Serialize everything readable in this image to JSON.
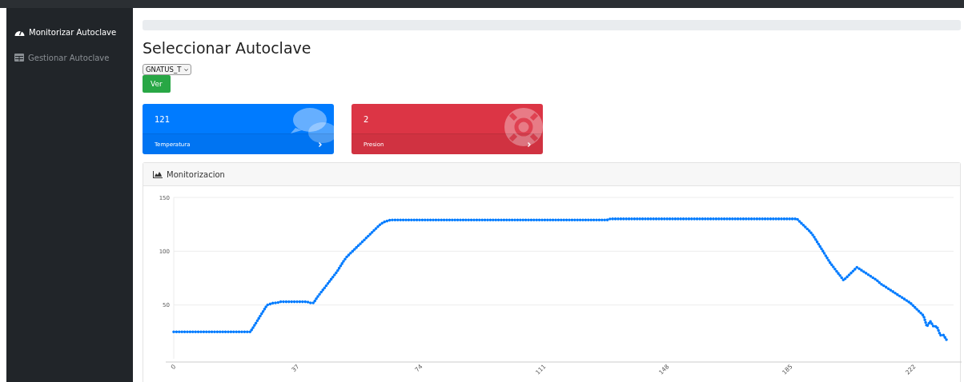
{
  "sidebar": {
    "items": [
      {
        "label": "Monitorizar Autoclave",
        "selected": true
      },
      {
        "label": "Gestionar Autoclave",
        "selected": false
      }
    ]
  },
  "page": {
    "title": "Seleccionar Autoclave",
    "select_value": "GNATUS_T",
    "button": "Ver"
  },
  "cards": [
    {
      "value": "121",
      "label": "Temperatura",
      "color": "#007bff"
    },
    {
      "value": "2",
      "label": "Presion",
      "color": "#dc3545"
    }
  ],
  "panel": {
    "title": "Monitorizacion",
    "chart_data": {
      "type": "line",
      "x": [
        0,
        1,
        2,
        3,
        4,
        5,
        6,
        7,
        8,
        9,
        10,
        11,
        12,
        13,
        14,
        15,
        16,
        17,
        18,
        19,
        20,
        21,
        22,
        23,
        24,
        25,
        26,
        27,
        28,
        29,
        30,
        31,
        32,
        33,
        34,
        35,
        36,
        37,
        38,
        39,
        40,
        41,
        42,
        43,
        44,
        45,
        46,
        47,
        48,
        49,
        50,
        51,
        52,
        53,
        54,
        55,
        56,
        57,
        58,
        59,
        60,
        61,
        62,
        63,
        64,
        65,
        66,
        67,
        68,
        69,
        70,
        71,
        72,
        73,
        74,
        75,
        76,
        77,
        78,
        79,
        80,
        81,
        82,
        83,
        84,
        85,
        86,
        87,
        88,
        89,
        90,
        91,
        92,
        93,
        94,
        95,
        96,
        97,
        98,
        99,
        100,
        101,
        102,
        103,
        104,
        105,
        106,
        107,
        108,
        109,
        110,
        111,
        112,
        113,
        114,
        115,
        116,
        117,
        118,
        119,
        120,
        121,
        122,
        123,
        124,
        125,
        126,
        127,
        128,
        129,
        130,
        131,
        132,
        133,
        134,
        135,
        136,
        137,
        138,
        139,
        140,
        141,
        142,
        143,
        144,
        145,
        146,
        147,
        148,
        149,
        150,
        151,
        152,
        153,
        154,
        155,
        156,
        157,
        158,
        159,
        160,
        161,
        162,
        163,
        164,
        165,
        166,
        167,
        168,
        169,
        170,
        171,
        172,
        173,
        174,
        175,
        176,
        177,
        178,
        179,
        180,
        181,
        182,
        183,
        184,
        185,
        186,
        187,
        188,
        189,
        190,
        191,
        192,
        193,
        194,
        195,
        196,
        197,
        198,
        199,
        200,
        201,
        202,
        203,
        204,
        205,
        206,
        207,
        208,
        209,
        210,
        211,
        212,
        213,
        214,
        215,
        216,
        217,
        218,
        219,
        220,
        221,
        222,
        223,
        224,
        225,
        226,
        227,
        228,
        229,
        230,
        231,
        232
      ],
      "xlim": [
        0,
        234
      ],
      "xticks": [
        0,
        37,
        74,
        111,
        148,
        185,
        222
      ],
      "yticks": [
        50,
        100,
        150
      ],
      "ylim": [
        0,
        150
      ],
      "series": [
        {
          "color": "#007bff",
          "line_style": "dotted",
          "values": [
            25,
            25,
            25,
            25,
            25,
            25,
            25,
            25,
            25,
            25,
            25,
            25,
            25,
            25,
            25,
            25,
            25,
            25,
            25,
            25,
            25,
            25,
            25,
            25,
            30,
            35,
            40,
            45,
            50,
            51,
            52,
            52,
            53,
            53,
            53,
            53,
            53,
            53,
            53,
            53,
            53,
            52,
            52,
            57,
            61,
            65,
            69,
            73,
            77,
            81,
            86,
            91,
            95,
            98,
            101,
            104,
            107,
            110,
            113,
            116,
            119,
            122,
            125,
            127,
            128,
            129,
            129,
            129,
            129,
            129,
            129,
            129,
            129,
            129,
            129,
            129,
            129,
            129,
            129,
            129,
            129,
            129,
            129,
            129,
            129,
            129,
            129,
            129,
            129,
            129,
            129,
            129,
            129,
            129,
            129,
            129,
            129,
            129,
            129,
            129,
            129,
            129,
            129,
            129,
            129,
            129,
            129,
            129,
            129,
            129,
            129,
            129,
            129,
            129,
            129,
            129,
            129,
            129,
            129,
            129,
            129,
            129,
            129,
            129,
            129,
            129,
            129,
            129,
            129,
            129,
            129,
            130,
            130,
            130,
            130,
            130,
            130,
            130,
            130,
            130,
            130,
            130,
            130,
            130,
            130,
            130,
            130,
            130,
            130,
            130,
            130,
            130,
            130,
            130,
            130,
            130,
            130,
            130,
            130,
            130,
            130,
            130,
            130,
            130,
            130,
            130,
            130,
            130,
            130,
            130,
            130,
            130,
            130,
            130,
            130,
            130,
            130,
            130,
            130,
            130,
            130,
            130,
            130,
            130,
            130,
            130,
            130,
            130,
            127,
            124,
            121,
            118,
            114,
            109,
            104,
            99,
            94,
            89,
            85,
            81,
            77,
            73,
            76,
            79,
            82,
            85,
            83,
            81,
            79,
            77,
            75,
            73,
            70,
            68,
            66,
            64,
            62,
            60,
            58,
            56,
            54,
            52,
            49,
            46,
            43,
            40,
            30,
            35,
            30,
            30,
            22,
            22,
            17
          ]
        }
      ]
    }
  }
}
